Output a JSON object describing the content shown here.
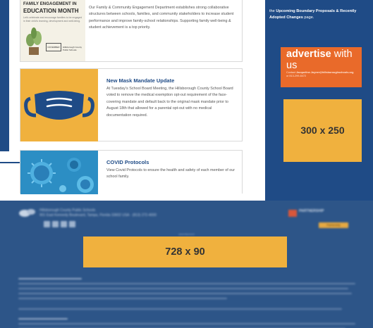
{
  "cards": [
    {
      "thumb": {
        "line1": "FAMILY ENGAGEMENT IN",
        "line2": "EDUCATION MONTH",
        "line3": "Let's celebrate and encourage families to be engaged in their child's learning, development and well-being.",
        "badge": "NOVEMBER",
        "logo": "Hillsborough County Public Schools"
      },
      "title": "",
      "text": "Our Family & Community Engagement Department establishes strong collaborative structures between schools, families, and community stakeholders to increase student performance and improve family-school relationships. Supporting family well-being & student achievement is a top priority."
    },
    {
      "title": "New Mask Mandate Update",
      "text": "At Tuesday's School Board Meeting, the Hillsborough County School Board voted to remove the medical exemption opt-out requirement of the face-covering mandate and default back to the original mask mandate prior to August 18th that allowed for a parental opt-out with no medical documentation required."
    },
    {
      "title": "COVID Protocols",
      "text": "View Covid Protocols to ensure the health and safety of each member of our school family."
    }
  ],
  "sidebar": {
    "text_pre": "the ",
    "text_bold": "Upcoming Boundary Proposals & Recently Adopted Changes",
    "text_post": " page.",
    "advertise": {
      "word1": "advertise",
      "word2": " with us",
      "contact_label": "Contact ",
      "contact_email": "Jacqueline.Joyner@hillsboroughschools.org",
      "contact_phone": "or 813-299-8472"
    },
    "ad_box": "300 x 250"
  },
  "footer": {
    "org_name": "Hillsborough County Public Schools",
    "org_address": "901 East Kennedy Boulevard, Tampa, Florida 33602 USA · (813) 272-4000",
    "partner": "PARTNERSHIP",
    "partner_button": "Partnership",
    "ad_label": "advertisement",
    "ad_box": "728 x 90"
  },
  "colors": {
    "brand_blue": "#1f4b86",
    "footer_blue": "#2d5588",
    "ad_yellow": "#f0b13e",
    "advertise_orange": "#e96a2a"
  },
  "icons": [
    "mask-icon",
    "virus-image",
    "district-logo-icon",
    "facebook-icon",
    "twitter-icon",
    "youtube-icon",
    "instagram-icon"
  ]
}
